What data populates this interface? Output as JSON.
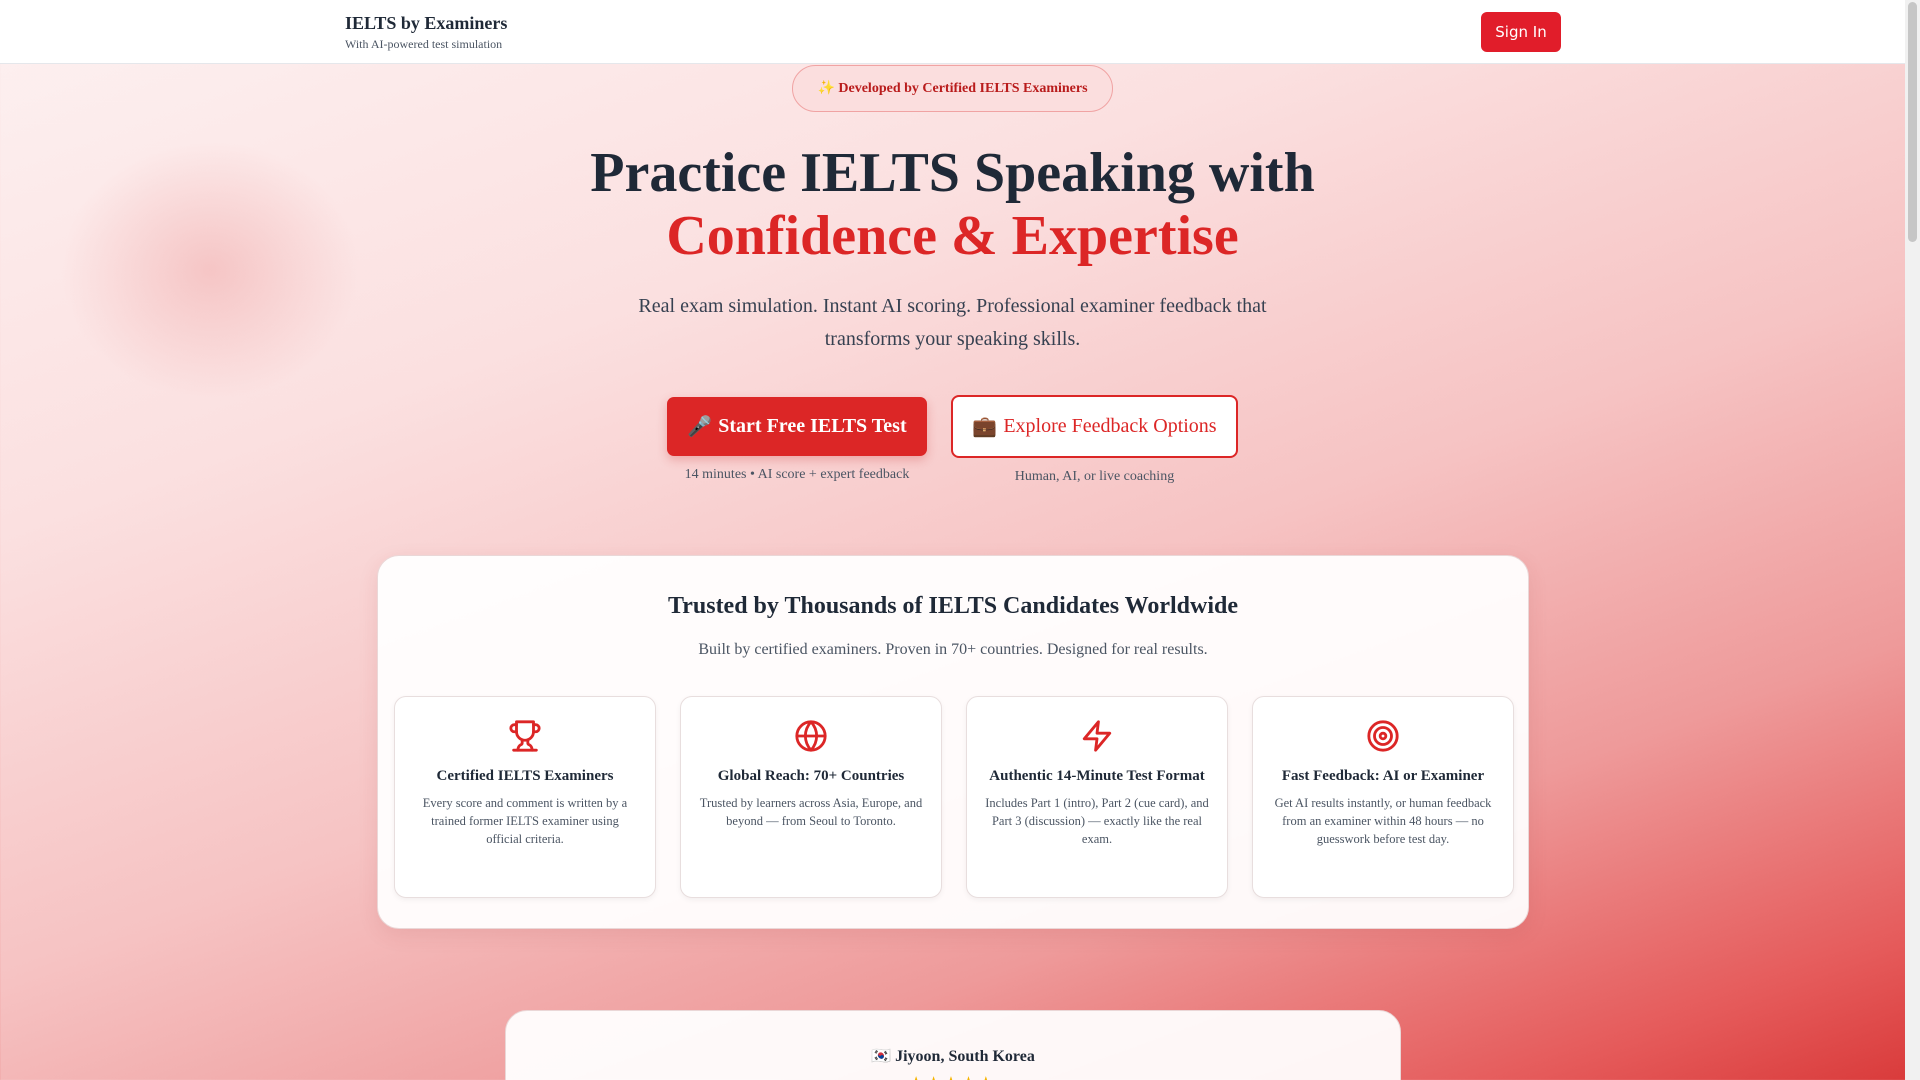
{
  "header": {
    "brand_title": "IELTS by Examiners",
    "brand_subtitle": "With AI-powered test simulation",
    "signin_label": "Sign In"
  },
  "hero": {
    "badge": "✨ Developed by Certified IELTS Examiners",
    "title_line1": "Practice IELTS Speaking with",
    "title_line2": "Confidence & Expertise",
    "subtitle": "Real exam simulation. Instant AI scoring. Professional examiner feedback that transforms your speaking skills.",
    "primary_button": {
      "icon": "🎤",
      "label": "Start Free IELTS Test",
      "note": "14 minutes • AI score + expert feedback"
    },
    "secondary_button": {
      "icon": "💼",
      "label": "Explore Feedback Options",
      "note": "Human, AI, or live coaching"
    }
  },
  "trust": {
    "title": "Trusted by Thousands of IELTS Candidates Worldwide",
    "subtitle": "Built by certified examiners. Proven in 70+ countries. Designed for real results.",
    "cards": [
      {
        "icon": "trophy-icon",
        "title": "Certified IELTS Examiners",
        "text": "Every score and comment is written by a trained former IELTS examiner using official criteria."
      },
      {
        "icon": "globe-icon",
        "title": "Global Reach: 70+ Countries",
        "text": "Trusted by learners across Asia, Europe, and beyond — from Seoul to Toronto."
      },
      {
        "icon": "lightning-icon",
        "title": "Authentic 14-Minute Test Format",
        "text": "Includes Part 1 (intro), Part 2 (cue card), and Part 3 (discussion) — exactly like the real exam."
      },
      {
        "icon": "target-icon",
        "title": "Fast Feedback: AI or Examiner",
        "text": "Get AI results instantly, or human feedback from an examiner within 48 hours — no guesswork before test day."
      }
    ]
  },
  "testimonial": {
    "flag": "🇰🇷",
    "name": "Jiyoon, South Korea",
    "stars": "★★★★★"
  },
  "colors": {
    "accent": "#dc2626",
    "button_red": "#e11d2a",
    "star": "#f5b400"
  }
}
